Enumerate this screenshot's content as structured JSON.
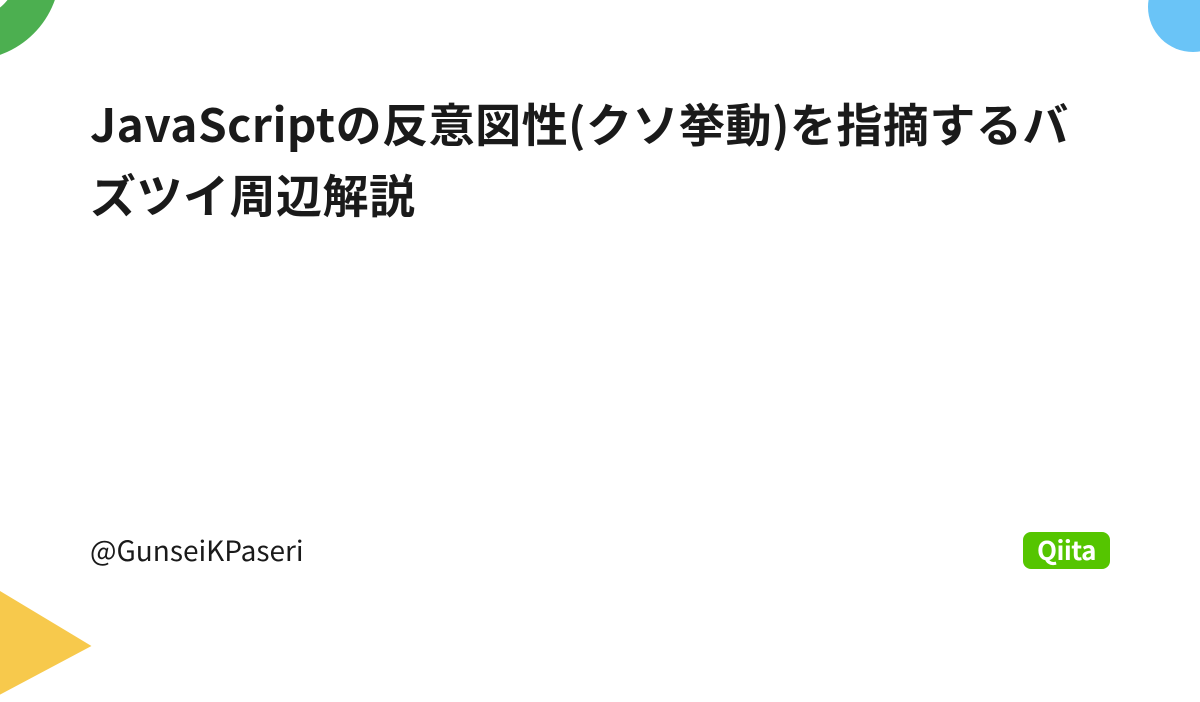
{
  "title": "JavaScriptの反意図性(クソ挙動)を指摘するバズツイ周辺解説",
  "author": "@GunseiKPaseri",
  "brand": {
    "name": "Qiita",
    "color": "#55c500"
  },
  "decorations": {
    "top_left_color": "#4caf50",
    "top_right_color": "#6ac4f7",
    "bottom_left_color": "#f7c94c"
  }
}
